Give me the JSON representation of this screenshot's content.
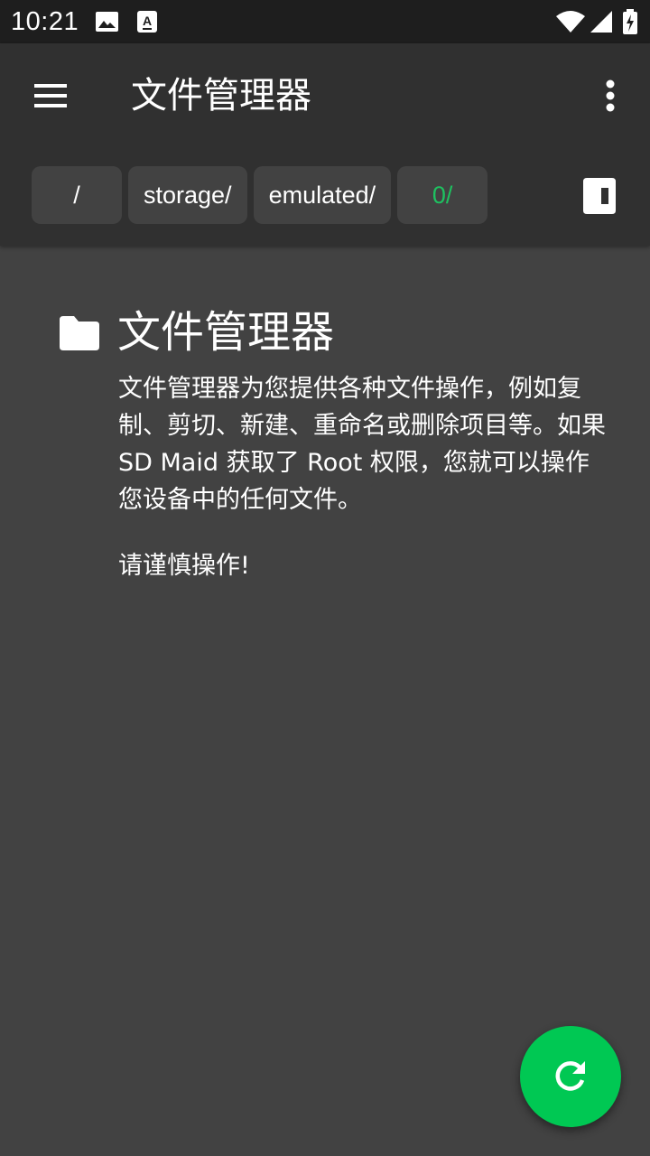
{
  "status_bar": {
    "time": "10:21",
    "icons": [
      "image-icon",
      "accessibility-notification-icon",
      "wifi-icon",
      "cell-signal-icon",
      "battery-charging-icon"
    ]
  },
  "app_bar": {
    "title": "文件管理器",
    "menu_icon": "hamburger-menu-icon",
    "overflow_icon": "more-vert-icon"
  },
  "breadcrumbs": [
    {
      "label": "/"
    },
    {
      "label": "storage/"
    },
    {
      "label": "emulated/"
    },
    {
      "label": "0/",
      "active": true
    }
  ],
  "empty_state": {
    "icon": "folder-icon",
    "title": "文件管理器",
    "description": "文件管理器为您提供各种文件操作，例如复制、剪切、新建、重命名或删除项目等。如果 SD Maid 获取了 Root 权限，您就可以操作您设备中的任何文件。",
    "warning": "请谨慎操作!"
  },
  "fab": {
    "icon": "refresh-icon"
  },
  "colors": {
    "accent": "#00c853",
    "active_crumb": "#1ec160",
    "background": "#424242",
    "app_bar": "#303030",
    "status_bar": "#1e1e1e"
  }
}
